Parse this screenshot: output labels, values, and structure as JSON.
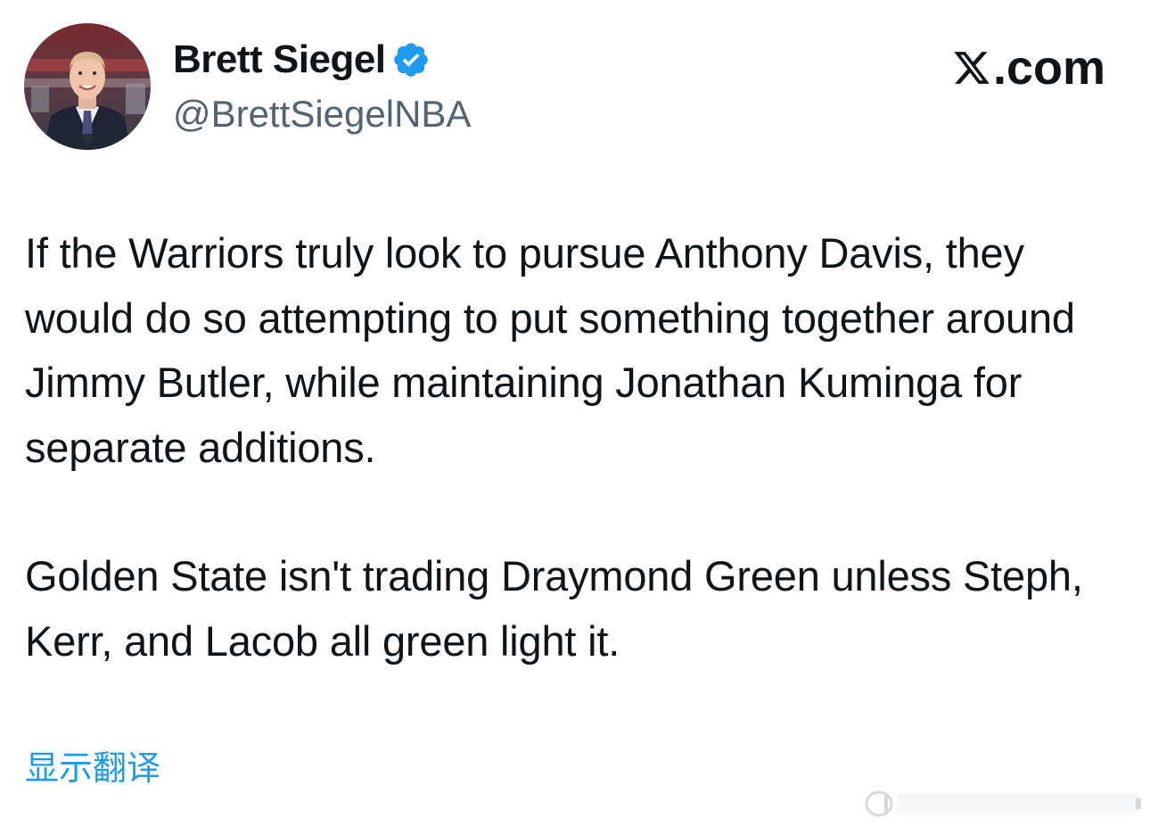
{
  "author": {
    "display_name": "Brett Siegel",
    "handle": "@BrettSiegelNBA",
    "verified": true,
    "avatar_icon": "profile-photo"
  },
  "site": {
    "logo_text": ".com",
    "logo_icon": "x-logo-icon"
  },
  "tweet": {
    "paragraphs": [
      "If the Warriors truly look to pursue Anthony Davis, they would do so attempting to put something together around Jimmy Butler, while maintaining Jonathan Kuminga for separate additions.",
      "Golden State isn't trading Draymond Green unless Steph, Kerr, and Lacob all green light it."
    ]
  },
  "translate_link": "显示翻译",
  "colors": {
    "text_primary": "#0f1419",
    "text_secondary": "#536471",
    "link": "#1d9bf0",
    "verified_badge": "#1d9bf0"
  }
}
